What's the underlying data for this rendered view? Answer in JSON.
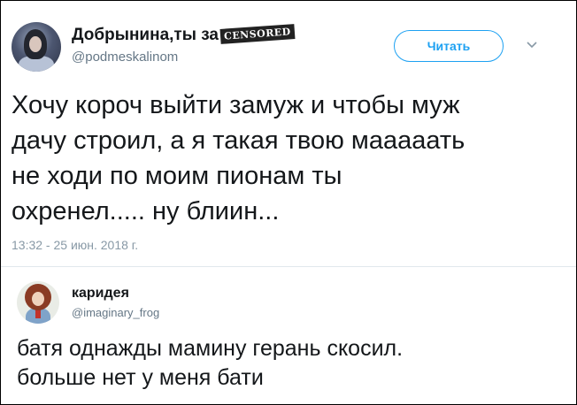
{
  "tweet": {
    "author_name": "Добрынина,ты за",
    "censored_stamp": "CENSORED",
    "handle": "@podmeskalinom",
    "follow_label": "Читать",
    "text_lines": [
      "Хочу короч выйти замуж и чтобы муж",
      "дачу строил, а я такая твою мааааать",
      "не ходи по моим пионам ты",
      "охренел..... ну блиин..."
    ],
    "timestamp": "13:32 - 25 июн. 2018 г."
  },
  "reply": {
    "author_name": "каридея",
    "handle": "@imaginary_frog",
    "text_lines": [
      "батя однажды мамину герань скосил.",
      "больше нет у меня бати"
    ]
  },
  "colors": {
    "accent": "#1da1f2",
    "text": "#14171a",
    "muted": "#657786",
    "divider": "#e1e8ed"
  },
  "icons": {
    "more": "chevron-down-icon"
  }
}
